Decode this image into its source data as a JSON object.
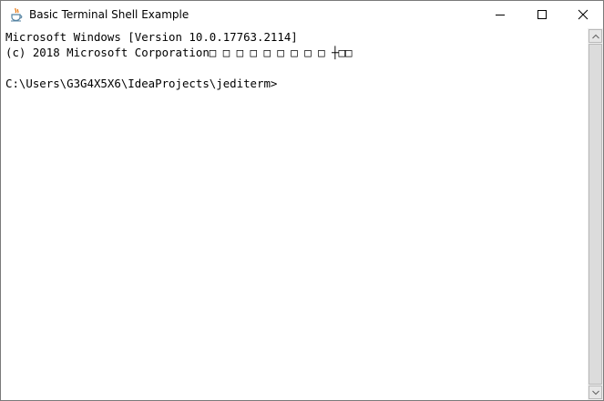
{
  "window": {
    "title": "Basic Terminal Shell Example",
    "icon": "java-coffee-cup-icon"
  },
  "controls": {
    "minimize_icon": "minimize-icon",
    "maximize_icon": "maximize-icon",
    "close_icon": "close-icon"
  },
  "terminal": {
    "lines": [
      "Microsoft Windows [Version 10.0.17763.2114]",
      "(c) 2018 Microsoft Corporation□ □ □ □ □ □ □ □ □ ┼□□",
      "",
      "C:\\Users\\G3G4X5X6\\IdeaProjects\\jediterm>"
    ]
  },
  "scrollbar": {
    "up_icon": "arrow-up-icon",
    "down_icon": "arrow-down-icon"
  }
}
